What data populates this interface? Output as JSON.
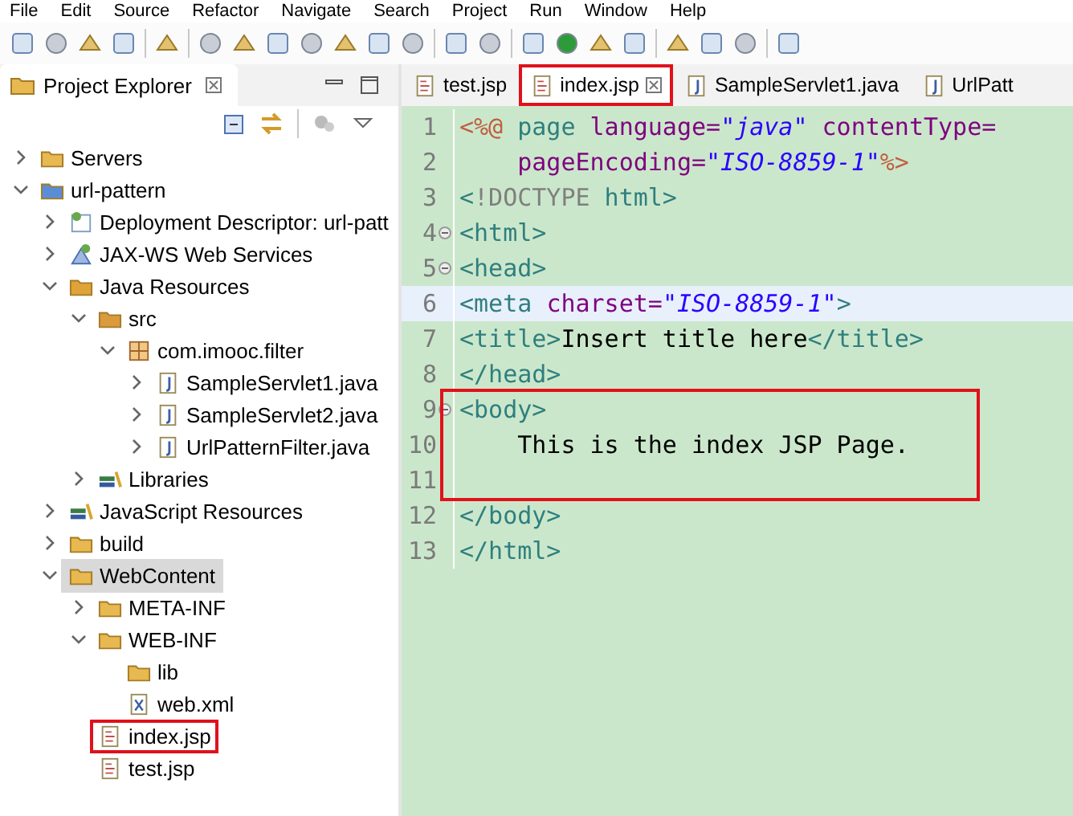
{
  "menu": [
    "File",
    "Edit",
    "Source",
    "Refactor",
    "Navigate",
    "Search",
    "Project",
    "Run",
    "Window",
    "Help"
  ],
  "explorer": {
    "title": "Project Explorer",
    "tree": [
      {
        "label": "Servers",
        "kind": "folder",
        "expanded": false,
        "selected": false,
        "annotated": false
      },
      {
        "label": "url-pattern",
        "kind": "project",
        "expanded": true,
        "selected": false,
        "annotated": false,
        "children": [
          {
            "label": "Deployment Descriptor: url-patt",
            "kind": "descriptor",
            "expanded": false,
            "selected": false,
            "annotated": false
          },
          {
            "label": "JAX-WS Web Services",
            "kind": "webservices",
            "expanded": false,
            "selected": false,
            "annotated": false
          },
          {
            "label": "Java Resources",
            "kind": "resources",
            "expanded": true,
            "selected": false,
            "annotated": false,
            "children": [
              {
                "label": "src",
                "kind": "src",
                "expanded": true,
                "selected": false,
                "annotated": false,
                "children": [
                  {
                    "label": "com.imooc.filter",
                    "kind": "package",
                    "expanded": true,
                    "selected": false,
                    "annotated": false,
                    "children": [
                      {
                        "label": "SampleServlet1.java",
                        "kind": "java",
                        "expanded": false,
                        "selected": false,
                        "annotated": false
                      },
                      {
                        "label": "SampleServlet2.java",
                        "kind": "java",
                        "expanded": false,
                        "selected": false,
                        "annotated": false
                      },
                      {
                        "label": "UrlPatternFilter.java",
                        "kind": "java",
                        "expanded": false,
                        "selected": false,
                        "annotated": false
                      }
                    ]
                  }
                ]
              },
              {
                "label": "Libraries",
                "kind": "library",
                "expanded": false,
                "selected": false,
                "annotated": false
              }
            ]
          },
          {
            "label": "JavaScript Resources",
            "kind": "library",
            "expanded": false,
            "selected": false,
            "annotated": false
          },
          {
            "label": "build",
            "kind": "folder",
            "expanded": false,
            "selected": false,
            "annotated": false
          },
          {
            "label": "WebContent",
            "kind": "folder",
            "expanded": true,
            "selected": true,
            "annotated": false,
            "children": [
              {
                "label": "META-INF",
                "kind": "folder",
                "expanded": false,
                "selected": false,
                "annotated": false
              },
              {
                "label": "WEB-INF",
                "kind": "folder",
                "expanded": true,
                "selected": false,
                "annotated": false,
                "children": [
                  {
                    "label": "lib",
                    "kind": "folder",
                    "selected": false,
                    "annotated": false
                  },
                  {
                    "label": "web.xml",
                    "kind": "xml",
                    "selected": false,
                    "annotated": false
                  }
                ]
              },
              {
                "label": "index.jsp",
                "kind": "jsp",
                "selected": false,
                "annotated": true
              },
              {
                "label": "test.jsp",
                "kind": "jsp",
                "selected": false,
                "annotated": false
              }
            ]
          }
        ]
      }
    ]
  },
  "tabs": [
    {
      "label": "test.jsp",
      "kind": "jsp",
      "selected": false,
      "annotated": false
    },
    {
      "label": "index.jsp",
      "kind": "jsp",
      "selected": true,
      "annotated": true
    },
    {
      "label": "SampleServlet1.java",
      "kind": "java",
      "selected": false,
      "annotated": false
    },
    {
      "label": "UrlPatt",
      "kind": "java",
      "selected": false,
      "annotated": false
    }
  ],
  "code": [
    {
      "number": "1",
      "foldable": false,
      "current": false,
      "boxed": false,
      "tokens": [
        {
          "kind": "directive",
          "text": "<%@"
        },
        {
          "kind": "tag",
          "text": " page "
        },
        {
          "kind": "attr",
          "text": "language="
        },
        {
          "kind": "value",
          "text": "\"java\""
        },
        {
          "kind": "attr",
          "text": " contentType="
        }
      ]
    },
    {
      "number": "2",
      "foldable": false,
      "current": false,
      "boxed": false,
      "tokens": [
        {
          "kind": "attr",
          "text": "    pageEncoding="
        },
        {
          "kind": "value",
          "text": "\"ISO-8859-1\""
        },
        {
          "kind": "directive",
          "text": "%>"
        }
      ]
    },
    {
      "number": "3",
      "foldable": false,
      "current": false,
      "boxed": false,
      "tokens": [
        {
          "kind": "tag",
          "text": "<"
        },
        {
          "kind": "doctype",
          "text": "!DOCTYPE"
        },
        {
          "kind": "tag",
          "text": " html>"
        }
      ]
    },
    {
      "number": "4",
      "foldable": true,
      "current": false,
      "boxed": false,
      "tokens": [
        {
          "kind": "tag",
          "text": "<html>"
        }
      ]
    },
    {
      "number": "5",
      "foldable": true,
      "current": false,
      "boxed": false,
      "tokens": [
        {
          "kind": "tag",
          "text": "<head>"
        }
      ]
    },
    {
      "number": "6",
      "foldable": false,
      "current": true,
      "boxed": false,
      "tokens": [
        {
          "kind": "tag",
          "text": "<meta "
        },
        {
          "kind": "attr",
          "text": "charset="
        },
        {
          "kind": "value",
          "text": "\"ISO-8859-1\""
        },
        {
          "kind": "tag",
          "text": ">"
        }
      ]
    },
    {
      "number": "7",
      "foldable": false,
      "current": false,
      "boxed": false,
      "tokens": [
        {
          "kind": "tag",
          "text": "<title>"
        },
        {
          "kind": "text",
          "text": "Insert title here"
        },
        {
          "kind": "tag",
          "text": "</title>"
        }
      ]
    },
    {
      "number": "8",
      "foldable": false,
      "current": false,
      "boxed": false,
      "tokens": [
        {
          "kind": "tag",
          "text": "</head>"
        }
      ]
    },
    {
      "number": "9",
      "foldable": true,
      "current": false,
      "boxed": true,
      "tokens": [
        {
          "kind": "tag",
          "text": "<body>"
        }
      ]
    },
    {
      "number": "10",
      "foldable": false,
      "current": false,
      "boxed": true,
      "tokens": [
        {
          "kind": "text",
          "text": "    This is the index JSP Page."
        }
      ]
    },
    {
      "number": "11",
      "foldable": false,
      "current": false,
      "boxed": true
    },
    {
      "number": "12",
      "foldable": false,
      "current": false,
      "boxed": false,
      "tokens": [
        {
          "kind": "tag",
          "text": "</body>"
        }
      ]
    },
    {
      "number": "13",
      "foldable": false,
      "current": false,
      "boxed": false,
      "tokens": [
        {
          "kind": "tag",
          "text": "</html>"
        }
      ]
    }
  ]
}
